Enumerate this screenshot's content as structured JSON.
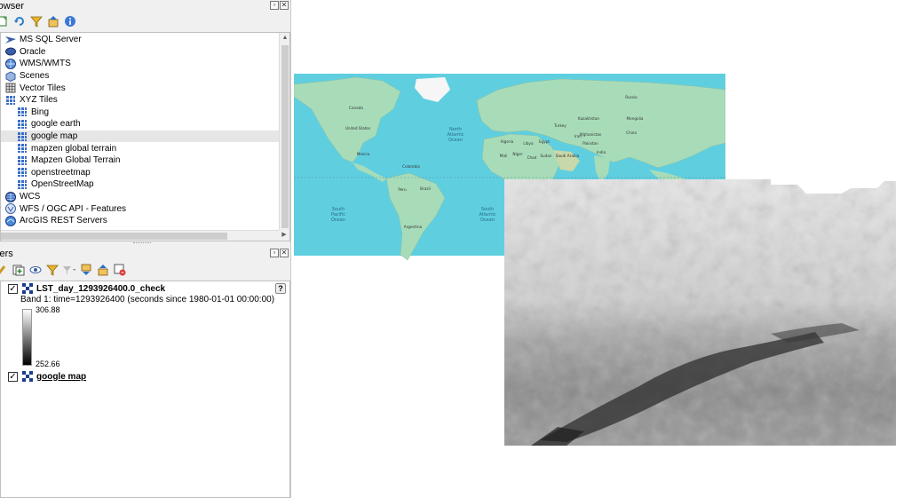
{
  "browser_panel": {
    "title": "rowser",
    "items": [
      {
        "label": "MS SQL Server",
        "icon": "mssql-icon"
      },
      {
        "label": "Oracle",
        "icon": "oracle-icon"
      },
      {
        "label": "WMS/WMTS",
        "icon": "wms-globe-icon"
      },
      {
        "label": "Scenes",
        "icon": "scenes-icon"
      },
      {
        "label": "Vector Tiles",
        "icon": "vector-tiles-icon"
      },
      {
        "label": "XYZ Tiles",
        "icon": "xyz-tiles-icon"
      },
      {
        "label": "Bing",
        "icon": "tile-grid-icon"
      },
      {
        "label": "google earth",
        "icon": "tile-grid-icon"
      },
      {
        "label": "google map",
        "icon": "tile-grid-icon",
        "selected": true
      },
      {
        "label": "mapzen global terrain",
        "icon": "tile-grid-icon"
      },
      {
        "label": "Mapzen Global Terrain",
        "icon": "tile-grid-icon"
      },
      {
        "label": "openstreetmap",
        "icon": "tile-grid-icon"
      },
      {
        "label": "OpenStreetMap",
        "icon": "tile-grid-icon"
      },
      {
        "label": "WCS",
        "icon": "wcs-globe-icon"
      },
      {
        "label": "WFS / OGC API - Features",
        "icon": "wfs-icon"
      },
      {
        "label": "ArcGIS REST Servers",
        "icon": "arcgis-icon"
      }
    ]
  },
  "layers_panel": {
    "title": "yers",
    "layers": [
      {
        "name": "LST_day_1293926400.0_check",
        "checked": true,
        "band_label": "Band 1: time=1293926400 (seconds since 1980-01-01 00:00:00)",
        "ramp_max": "306.88",
        "ramp_min": "252.66"
      },
      {
        "name": "google map",
        "checked": true
      }
    ]
  },
  "map": {
    "labels": [
      "North Atlantic Ocean",
      "South Pacific Ocean",
      "South Atlantic Ocean",
      "United States",
      "Canada",
      "Mexico",
      "Brazil",
      "Peru",
      "Argentina",
      "Colombia",
      "Algeria",
      "Libya",
      "Egypt",
      "Niger",
      "Sudan",
      "Mali",
      "Chad",
      "Turkey",
      "Iran",
      "Afghanistan",
      "Pakistan",
      "India",
      "Saudi Arabia",
      "Kazakhstan",
      "Mongolia",
      "China",
      "Russia"
    ]
  },
  "colors": {
    "ocean": "#5fcfe0",
    "land": "#a8dcb9",
    "panel_bg": "#f0f0f0",
    "selected_row": "#e6e6e6"
  }
}
